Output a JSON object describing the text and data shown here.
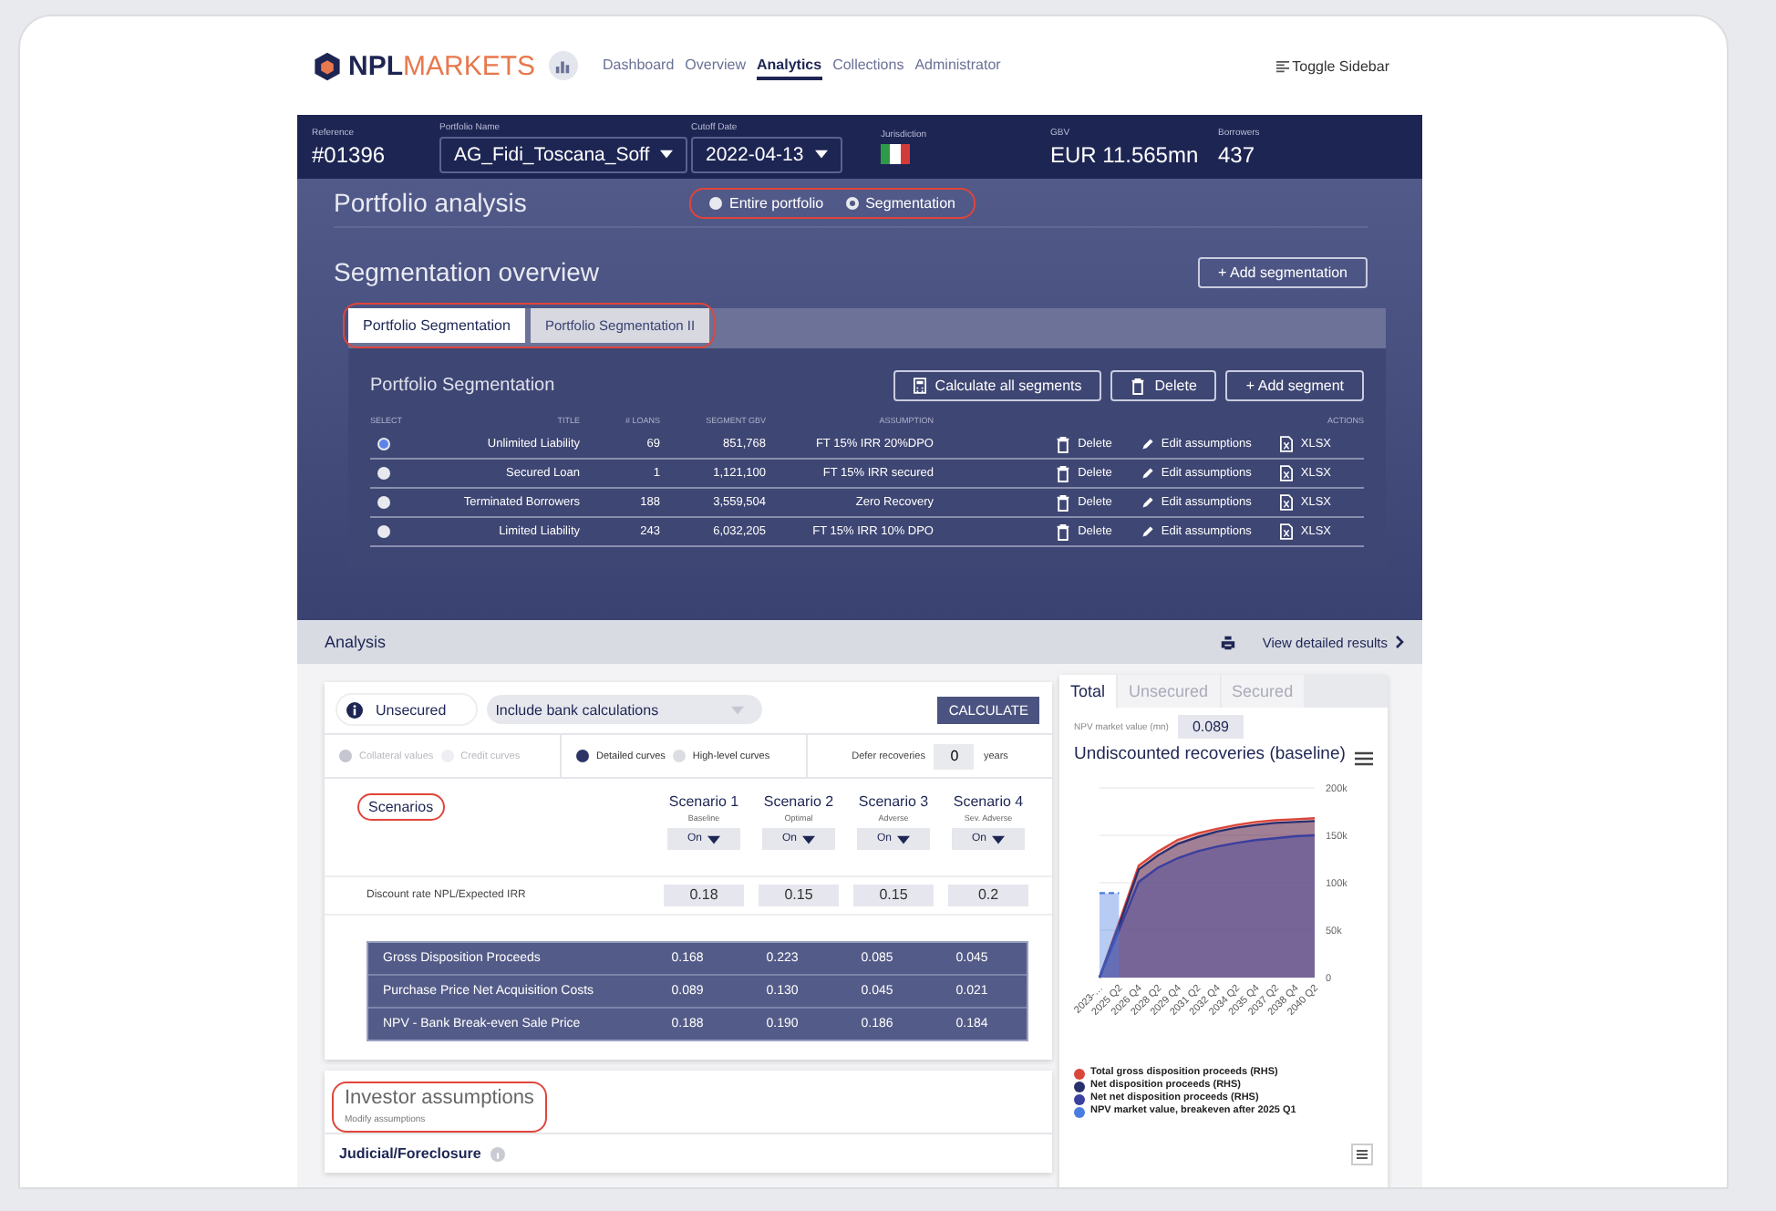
{
  "nav": {
    "logo": {
      "bold": "NPL",
      "light": "MARKETS"
    },
    "links": [
      {
        "label": "Dashboard",
        "selected": false
      },
      {
        "label": "Overview",
        "selected": false
      },
      {
        "label": "Analytics",
        "selected": true
      },
      {
        "label": "Collections",
        "selected": false
      },
      {
        "label": "Administrator",
        "selected": false
      }
    ],
    "toggle": "Toggle Sidebar"
  },
  "portfolio_bar": {
    "fields": [
      {
        "label": "Reference",
        "kind": "text",
        "value": "#01396"
      },
      {
        "label": "Portfolio Name",
        "kind": "dropdown",
        "value": "AG_Fidi_Toscana_Soff"
      },
      {
        "label": "Cutoff Date",
        "kind": "dropdown",
        "value": "2022-04-13"
      },
      {
        "label": "Jurisdiction",
        "kind": "flag"
      },
      {
        "label": "GBV",
        "kind": "text",
        "value": "EUR 11.565mn"
      },
      {
        "label": "Borrowers",
        "kind": "text",
        "value": "437"
      }
    ]
  },
  "portfolio_analysis": {
    "title": "Portfolio analysis",
    "highlighted": true,
    "options": [
      {
        "label": "Entire portfolio",
        "selected": false
      },
      {
        "label": "Segmentation",
        "selected": true
      }
    ]
  },
  "segmentation": {
    "title": "Segmentation overview",
    "add_button": "+ Add segmentation",
    "tabs_highlighted": true,
    "tabs": [
      {
        "label": "Portfolio Segmentation",
        "selected": true
      },
      {
        "label": "Portfolio Segmentation II",
        "selected": false
      }
    ],
    "panel": {
      "title": "Portfolio Segmentation",
      "buttons": [
        {
          "label": "Calculate all segments",
          "kind": "calculator"
        },
        {
          "label": "Delete",
          "kind": "trash"
        },
        {
          "label": "+ Add segment",
          "kind": "plain"
        }
      ],
      "columns": [
        "SELECT",
        "TITLE",
        "# LOANS",
        "SEGMENT GBV",
        "ASSUMPTION",
        "ACTIONS"
      ],
      "rows": [
        {
          "selected": true,
          "title": "Unlimited Liability",
          "loans": "69",
          "gbv": "851,768",
          "assumption": "FT 15% IRR 20%DPO",
          "delete": "Delete",
          "edit": "Edit assumptions",
          "export": "XLSX"
        },
        {
          "selected": false,
          "title": "Secured Loan",
          "loans": "1",
          "gbv": "1,121,100",
          "assumption": "FT 15% IRR secured",
          "delete": "Delete",
          "edit": "Edit assumptions",
          "export": "XLSX"
        },
        {
          "selected": false,
          "title": "Terminated Borrowers",
          "loans": "188",
          "gbv": "3,559,504",
          "assumption": "Zero Recovery",
          "delete": "Delete",
          "edit": "Edit assumptions",
          "export": "XLSX"
        },
        {
          "selected": false,
          "title": "Limited Liability",
          "loans": "243",
          "gbv": "6,032,205",
          "assumption": "FT 15% IRR 10% DPO",
          "delete": "Delete",
          "edit": "Edit assumptions",
          "export": "XLSX"
        }
      ]
    }
  },
  "analysis": {
    "title": "Analysis",
    "results_link": "View detailed results",
    "calculator": {
      "chips": [
        {
          "label": "Unsecured",
          "kind": "info"
        },
        {
          "label": "Include bank calculations",
          "kind": "dropdown"
        }
      ],
      "calculate_button": "CALCULATE",
      "option_groups": [
        {
          "disabled": true,
          "options": [
            {
              "label": "Collateral values",
              "selected": true
            },
            {
              "label": "Credit curves",
              "selected": false
            }
          ]
        },
        {
          "disabled": false,
          "options": [
            {
              "label": "Detailed curves",
              "selected": true
            },
            {
              "label": "High-level curves",
              "selected": false
            }
          ]
        }
      ],
      "defer": {
        "label": "Defer recoveries",
        "value": "0",
        "unit": "years"
      },
      "scenarios": {
        "title": "Scenarios",
        "highlighted": true,
        "items": [
          {
            "name": "Scenario 1",
            "subtitle": "Baseline",
            "state": "On"
          },
          {
            "name": "Scenario 2",
            "subtitle": "Optimal",
            "state": "On"
          },
          {
            "name": "Scenario 3",
            "subtitle": "Adverse",
            "state": "On"
          },
          {
            "name": "Scenario 4",
            "subtitle": "Sev. Adverse",
            "state": "On"
          }
        ]
      },
      "discount": {
        "label": "Discount rate NPL/Expected IRR",
        "values": [
          "0.18",
          "0.15",
          "0.15",
          "0.2"
        ]
      },
      "results": [
        {
          "label": "Gross Disposition Proceeds",
          "values": [
            "0.168",
            "0.223",
            "0.085",
            "0.045"
          ]
        },
        {
          "label": "Purchase Price Net Acquisition Costs",
          "values": [
            "0.089",
            "0.130",
            "0.045",
            "0.021"
          ]
        },
        {
          "label": "NPV - Bank Break-even Sale Price",
          "values": [
            "0.188",
            "0.190",
            "0.186",
            "0.184"
          ]
        }
      ]
    },
    "investor": {
      "title": "Investor assumptions",
      "subtitle": "Modify assumptions",
      "highlighted": true,
      "section": "Judicial/Foreclosure"
    }
  },
  "recoveries": {
    "tabs": [
      {
        "label": "Total",
        "selected": true
      },
      {
        "label": "Unsecured",
        "selected": false
      },
      {
        "label": "Secured",
        "selected": false
      }
    ],
    "npv_label": "NPV market value (mn)",
    "npv_value": "0.089",
    "chart_data": {
      "type": "area",
      "grid": true,
      "title": "Undiscounted recoveries (baseline)",
      "categories": [
        "2023-…",
        "2025 Q2",
        "2026 Q4",
        "2028 Q2",
        "2029 Q4",
        "2031 Q2",
        "2032 Q4",
        "2034 Q2",
        "2035 Q4",
        "2037 Q2",
        "2038 Q4",
        "2040 Q2"
      ],
      "yticks": [
        {
          "value": 0,
          "label": "0"
        },
        {
          "value": 50000,
          "label": "50k"
        },
        {
          "value": 100000,
          "label": "100k"
        },
        {
          "value": 150000,
          "label": "150k"
        },
        {
          "value": 200000,
          "label": "200k"
        }
      ],
      "ylim": [
        0,
        200000
      ],
      "series": [
        {
          "name": "Total gross disposition proceeds (RHS)",
          "color": "#d9463a",
          "values": [
            0,
            58000,
            118000,
            133000,
            145000,
            152000,
            157000,
            161000,
            164000,
            166000,
            167000,
            168000
          ]
        },
        {
          "name": "Net disposition proceeds (RHS)",
          "color": "#2a2f6e",
          "values": [
            0,
            55000,
            114000,
            129000,
            141000,
            148000,
            154000,
            158000,
            161000,
            163000,
            164000,
            165000
          ]
        },
        {
          "name": "Net net disposition proceeds (RHS)",
          "color": "#3b3f9e",
          "values": [
            0,
            50000,
            101000,
            116000,
            126000,
            133000,
            138000,
            142000,
            145000,
            147000,
            149000,
            150000
          ]
        },
        {
          "name": "NPV market value, breakeven after 2025 Q1",
          "color": "#4a7de0",
          "line_style": "dashed",
          "type": "area",
          "values": [
            89000,
            89000,
            null,
            null,
            null,
            null,
            null,
            null,
            null,
            null,
            null,
            null
          ]
        }
      ]
    }
  }
}
